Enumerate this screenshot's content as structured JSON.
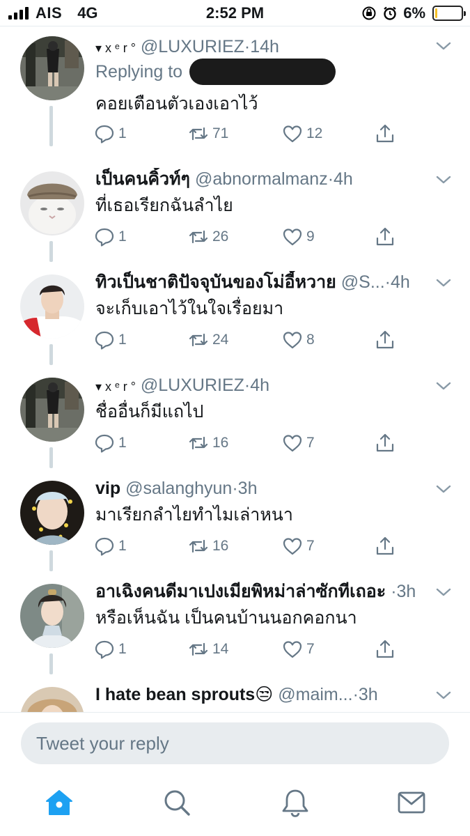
{
  "status_bar": {
    "carrier": "AIS",
    "network": "4G",
    "time": "2:52 PM",
    "battery_percent_text": "6%",
    "battery_level": 0.06,
    "icons": [
      "signal-icon",
      "orientation-lock-icon",
      "alarm-icon",
      "battery-icon"
    ]
  },
  "colors": {
    "accent": "#1da1f2",
    "secondary_text": "#657786",
    "thread_line": "#cfd9de",
    "battery_low": "#f6c026"
  },
  "tweets": [
    {
      "name": "▾ x ᵉ r °",
      "handle": "@LUXURIEZ",
      "separator": "·",
      "time": "14h",
      "replying_to": "Replying to",
      "text": "คอยเตือนตัวเองเอาไว้",
      "replies": "1",
      "retweets": "71",
      "likes": "12"
    },
    {
      "name": "เป็นคนคิ้วท์ๆ",
      "handle": "@abnormalmanz",
      "separator": "·",
      "time": "4h",
      "text": "ที่เธอเรียกฉันลำไย",
      "replies": "1",
      "retweets": "26",
      "likes": "9"
    },
    {
      "name": "ทิวเป็นชาติปัจจุบันของโม่อี้หวาย",
      "handle": "@S...",
      "separator": "·",
      "time": "4h",
      "text": "จะเก็บเอาไว้ในใจเรื่อยมา",
      "replies": "1",
      "retweets": "24",
      "likes": "8"
    },
    {
      "name": "▾ x ᵉ r °",
      "handle": "@LUXURIEZ",
      "separator": "·",
      "time": "4h",
      "text": "ชื่ออื่นก็มีแถไป",
      "replies": "1",
      "retweets": "16",
      "likes": "7"
    },
    {
      "name": "vip",
      "handle": "@salanghyun",
      "separator": "·",
      "time": "3h",
      "text": "มาเรียกลำไยทำไมเล่าหนา",
      "replies": "1",
      "retweets": "16",
      "likes": "7"
    },
    {
      "name": "อาเฉิงคนดีมาเปงเมียพิหม่าล่าซักทีเถอะ",
      "handle": "",
      "separator": "·",
      "time": "3h",
      "text": "หรือเห็นฉัน เป็นคนบ้านนอกคอกนา",
      "replies": "1",
      "retweets": "14",
      "likes": "7"
    },
    {
      "name": "I hate bean sprouts😒",
      "handle": "@maim...",
      "separator": "·",
      "time": "3h",
      "text": "",
      "replies": "",
      "retweets": "",
      "likes": ""
    }
  ],
  "reply_box": {
    "placeholder": "Tweet your reply"
  },
  "tab_bar": {
    "tabs": [
      {
        "icon": "home-icon",
        "active": true
      },
      {
        "icon": "search-icon",
        "active": false
      },
      {
        "icon": "notifications-icon",
        "active": false
      },
      {
        "icon": "messages-icon",
        "active": false
      }
    ]
  }
}
